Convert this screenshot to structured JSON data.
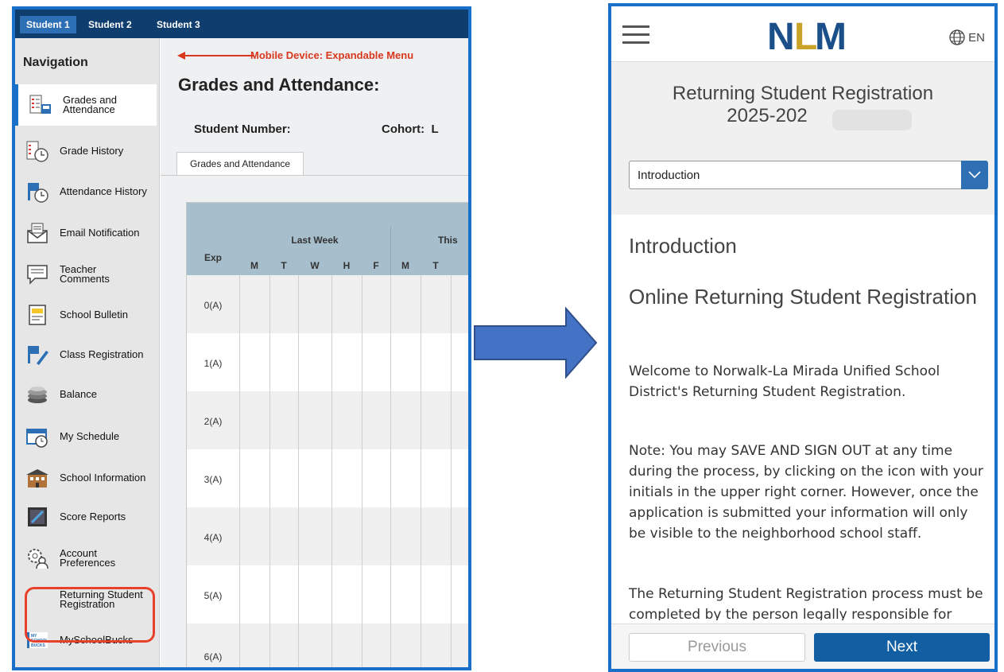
{
  "left_app": {
    "student_tabs": [
      "Student 1",
      "Student 2",
      "Student 3"
    ],
    "nav_title": "Navigation",
    "nav_items": [
      {
        "label": "Grades and Attendance",
        "icon": "grades-attendance-icon"
      },
      {
        "label": "Grade History",
        "icon": "grade-history-icon"
      },
      {
        "label": "Attendance History",
        "icon": "attendance-history-icon"
      },
      {
        "label": "Email Notification",
        "icon": "email-notification-icon"
      },
      {
        "label": "Teacher Comments",
        "icon": "teacher-comments-icon"
      },
      {
        "label": "School Bulletin",
        "icon": "school-bulletin-icon"
      },
      {
        "label": "Class Registration",
        "icon": "class-registration-icon"
      },
      {
        "label": "Balance",
        "icon": "balance-icon"
      },
      {
        "label": "My Schedule",
        "icon": "my-schedule-icon"
      },
      {
        "label": "School Information",
        "icon": "school-information-icon"
      },
      {
        "label": "Score Reports",
        "icon": "score-reports-icon"
      },
      {
        "label": "Account Preferences",
        "icon": "account-preferences-icon"
      },
      {
        "label": "Returning Student Registration",
        "icon": ""
      },
      {
        "label": "MySchoolBucks",
        "icon": "myschoolbucks-icon"
      }
    ],
    "myschoolbucks_logo_text": "MY SCHOOL BUCKS",
    "annotation": "Mobile Device: Expandable Menu",
    "page_title": "Grades and Attendance:",
    "student_number_label": "Student Number:",
    "cohort_label": "Cohort:",
    "cohort_value_partial": "L",
    "content_tab": "Grades and Attendance",
    "grid": {
      "exp_header": "Exp",
      "last_week_header": "Last Week",
      "this_week_header_partial": "This",
      "day_headers": [
        "M",
        "T",
        "W",
        "H",
        "F",
        "M",
        "T"
      ],
      "rows": [
        "0(A)",
        "1(A)",
        "2(A)",
        "3(A)",
        "4(A)",
        "5(A)",
        "6(A)"
      ]
    },
    "colors": {
      "top_bar": "#0f3d6e",
      "active_tab": "#2d6fb5",
      "grid_header": "#a7bfcc",
      "highlight": "#e8402a"
    }
  },
  "right_app": {
    "logo_text": "NLM",
    "language": "EN",
    "registration_title": "Returning Student Registration",
    "registration_year_partial": "2025-202",
    "step_selector_value": "Introduction",
    "section_heading": "Introduction",
    "subheading": "Online Returning Student Registration",
    "paragraphs": [
      "Welcome to Norwalk-La Mirada Unified School District's Returning Student Registration.",
      "Note: You may SAVE AND SIGN OUT at any time during the process, by clicking on the icon with your initials in the upper right corner. However, once the application is submitted your information will only be visible to the neighborhood school staff.",
      "The Returning Student Registration process must be completed by the person legally responsible for"
    ],
    "previous_label": "Previous",
    "next_label": "Next",
    "colors": {
      "primary": "#115ea3",
      "logo_blue": "#1b4f8a",
      "logo_gold": "#c9a227"
    }
  }
}
